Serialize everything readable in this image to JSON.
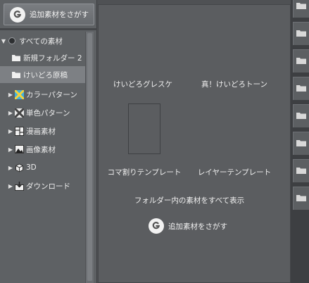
{
  "search_button": {
    "label": "追加素材をさがす"
  },
  "tree": {
    "items": [
      {
        "label": "すべての素材",
        "expand": "▼",
        "icon": "root-icon",
        "selected": false
      },
      {
        "label": "新規フォルダー 2",
        "expand": "",
        "icon": "folder-icon",
        "selected": false
      },
      {
        "label": "けいどろ原稿",
        "expand": "",
        "icon": "folder-icon",
        "selected": true
      },
      {
        "label": "カラーパターン",
        "expand": "▶",
        "icon": "color-pattern-icon",
        "selected": false
      },
      {
        "label": "単色パターン",
        "expand": "▶",
        "icon": "mono-pattern-icon",
        "selected": false
      },
      {
        "label": "漫画素材",
        "expand": "▶",
        "icon": "manga-icon",
        "selected": false
      },
      {
        "label": "画像素材",
        "expand": "▶",
        "icon": "image-icon",
        "selected": false
      },
      {
        "label": "3D",
        "expand": "▶",
        "icon": "3d-icon",
        "selected": false
      },
      {
        "label": "ダウンロード",
        "expand": "▶",
        "icon": "download-icon",
        "selected": false
      }
    ]
  },
  "center": {
    "subfolders": [
      {
        "label": "けいどろグレスケ"
      },
      {
        "label": "真！けいどろトーン"
      },
      {
        "label": "コマ割りテンプレート"
      },
      {
        "label": "レイヤーテンプレート"
      }
    ],
    "show_all_label": "フォルダー内の素材をすべて表示",
    "add_label": "追加素材をさがす"
  },
  "right_strip": {
    "buttons": [
      "folder-icon",
      "folder-icon",
      "folder-icon",
      "folder-icon",
      "folder-icon",
      "folder-icon",
      "folder-icon",
      "folder-icon"
    ]
  },
  "colors": {
    "panel": "#5b5d60",
    "selected": "#7d8084",
    "accent_icon": "#3fb0e0"
  }
}
